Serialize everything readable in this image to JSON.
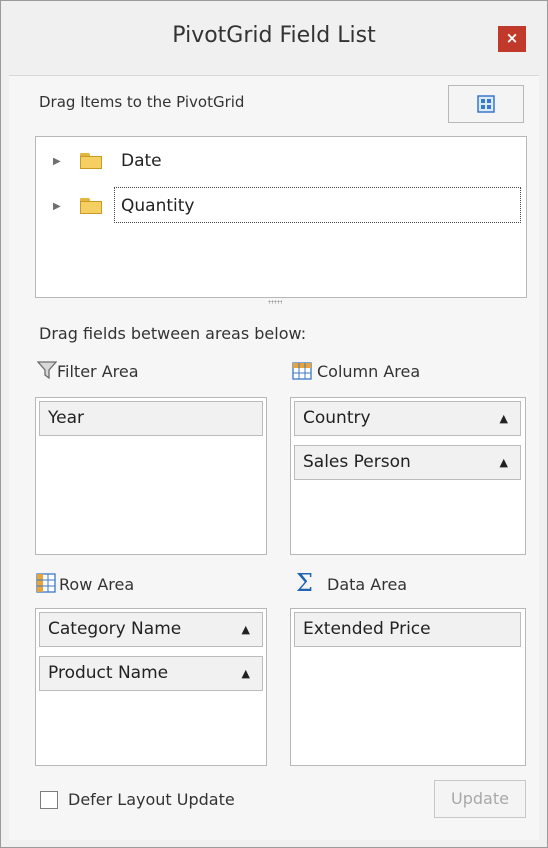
{
  "window": {
    "title": "PivotGrid Field List",
    "close_symbol": "×"
  },
  "toolbar": {
    "instructions": "Drag Items to the PivotGrid",
    "layout_button_icon": "layout-grid-icon"
  },
  "field_list": {
    "items": [
      {
        "label": "Date",
        "icon": "folder-icon"
      },
      {
        "label": "Quantity",
        "icon": "folder-icon"
      }
    ]
  },
  "areas_label": "Drag fields between areas below:",
  "areas": {
    "filter": {
      "title": "Filter Area",
      "icon": "filter-icon",
      "fields": [
        "Year"
      ]
    },
    "column": {
      "title": "Column Area",
      "icon": "column-area-icon",
      "fields": [
        "Country",
        "Sales Person"
      ]
    },
    "row": {
      "title": "Row Area",
      "icon": "row-area-icon",
      "fields": [
        "Category Name",
        "Product Name"
      ]
    },
    "data": {
      "title": "Data Area",
      "icon": "sigma-icon",
      "fields": [
        "Extended Price"
      ]
    }
  },
  "footer": {
    "defer_label": "Defer Layout Update",
    "defer_checked": false,
    "update_label": "Update"
  },
  "glyphs": {
    "sort_up": "▲",
    "sigma": "Σ",
    "expander": "▶"
  },
  "colors": {
    "close_button": "#c0392b",
    "layout_icon": "#3a78c9",
    "folder": "#f5cf62",
    "sigma": "#1f63b3",
    "grid_icon": "#e8a33a"
  }
}
